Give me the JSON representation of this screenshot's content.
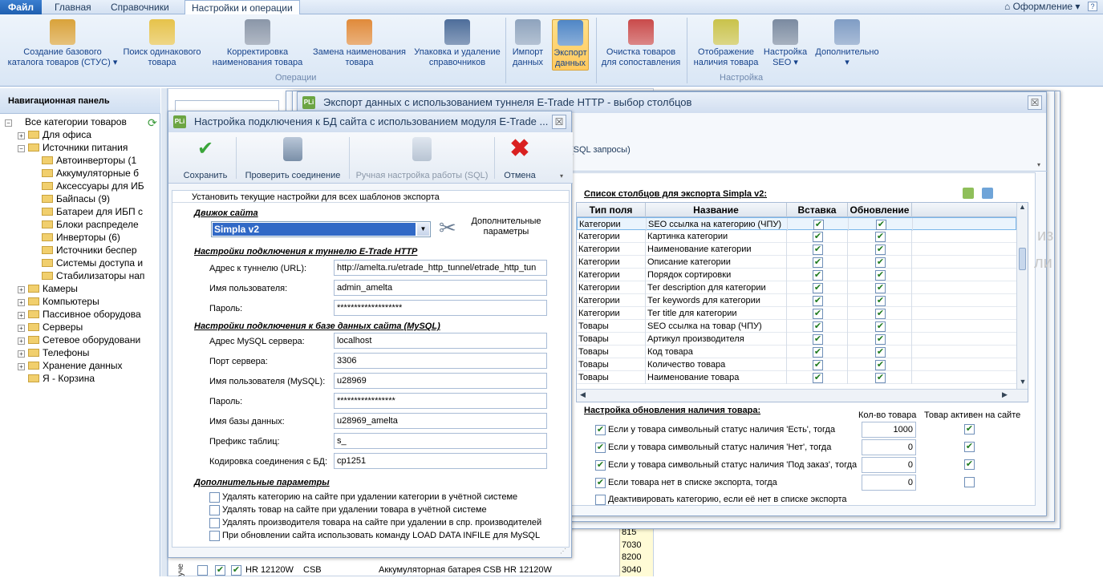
{
  "tabs": {
    "file": "Файл",
    "home": "Главная",
    "refs": "Справочники",
    "settings": "Настройки и операции",
    "design": "Оформление"
  },
  "ribbon": {
    "groups": {
      "operations": "Операции",
      "settings": "Настройка"
    },
    "buttons": [
      {
        "label1": "Создание базового",
        "label2": "каталога товаров (СТУС) ▾",
        "icon": "cubes-icon"
      },
      {
        "label1": "Поиск одинакового",
        "label2": "товара",
        "icon": "search-pen-icon"
      },
      {
        "label1": "Корректировка",
        "label2": "наименования товара",
        "icon": "book-icon"
      },
      {
        "label1": "Замена наименования",
        "label2": "товара",
        "icon": "replace-icon"
      },
      {
        "label1": "Упаковка и удаление",
        "label2": "справочников",
        "icon": "database-icon"
      },
      {
        "label1": "Импорт",
        "label2": "данных",
        "icon": "database-import-icon"
      },
      {
        "label1": "Экспорт",
        "label2": "данных",
        "icon": "database-export-icon"
      },
      {
        "label1": "Очистка товаров",
        "label2": "для сопоставления",
        "icon": "clean-icon"
      },
      {
        "label1": "Отображение",
        "label2": "наличия товара",
        "icon": "pencil-icon"
      },
      {
        "label1": "Настройка",
        "label2": "SEO ▾",
        "icon": "seo-icon"
      },
      {
        "label1": "Дополнительно",
        "label2": "▾",
        "icon": "document-icon"
      }
    ]
  },
  "nav": {
    "title": "Навигационная панель",
    "items": [
      {
        "label": "Все категории товаров",
        "level": 0,
        "pm": "−"
      },
      {
        "label": "Для офиса",
        "level": 1,
        "pm": "+"
      },
      {
        "label": "Источники питания",
        "level": 1,
        "pm": "−"
      },
      {
        "label": "Автоинверторы (1",
        "level": 2,
        "pm": ""
      },
      {
        "label": "Аккумуляторные б",
        "level": 2,
        "pm": ""
      },
      {
        "label": "Аксессуары для ИБ",
        "level": 2,
        "pm": ""
      },
      {
        "label": "Байпасы (9)",
        "level": 2,
        "pm": ""
      },
      {
        "label": "Батареи для ИБП с",
        "level": 2,
        "pm": ""
      },
      {
        "label": "Блоки распределе",
        "level": 2,
        "pm": ""
      },
      {
        "label": "Инверторы (6)",
        "level": 2,
        "pm": ""
      },
      {
        "label": "Источники беспер",
        "level": 2,
        "pm": ""
      },
      {
        "label": "Системы доступа и",
        "level": 2,
        "pm": ""
      },
      {
        "label": "Стабилизаторы нап",
        "level": 2,
        "pm": ""
      },
      {
        "label": "Камеры",
        "level": 1,
        "pm": "+"
      },
      {
        "label": "Компьютеры",
        "level": 1,
        "pm": "+"
      },
      {
        "label": "Пассивное оборудова",
        "level": 1,
        "pm": "+"
      },
      {
        "label": "Серверы",
        "level": 1,
        "pm": "+"
      },
      {
        "label": "Сетевое оборудовани",
        "level": 1,
        "pm": "+"
      },
      {
        "label": "Телефоны",
        "level": 1,
        "pm": "+"
      },
      {
        "label": "Хранение данных",
        "level": 1,
        "pm": "+"
      },
      {
        "label": "Я - Корзина",
        "level": 1,
        "pm": ""
      }
    ]
  },
  "back_grid": {
    "row": {
      "model": "HR 12120W",
      "brand": "CSB",
      "name": "Аккумуляторная батарея CSB HR 12120W"
    },
    "prices": [
      "815",
      "7030",
      "8200",
      "3040"
    ],
    "side_label": "уче"
  },
  "export_win": {
    "title": "Экспорт данных с использованием туннеля E-Trade HTTP - выбор столбцов",
    "sql_link": "(SQL запросы)",
    "columns_title": "Список столбцов для экспорта Simpla v2:",
    "headers": [
      "Тип поля",
      "Название",
      "Вставка",
      "Обновление"
    ],
    "rows": [
      {
        "type": "Категории",
        "name": "SEO ссылка на категорию (ЧПУ)"
      },
      {
        "type": "Категории",
        "name": "Картинка категории"
      },
      {
        "type": "Категории",
        "name": "Наименование категории"
      },
      {
        "type": "Категории",
        "name": "Описание категории"
      },
      {
        "type": "Категории",
        "name": "Порядок сортировки"
      },
      {
        "type": "Категории",
        "name": "Тег description для категории"
      },
      {
        "type": "Категории",
        "name": "Тег keywords для категории"
      },
      {
        "type": "Категории",
        "name": "Тег title для категории"
      },
      {
        "type": "Товары",
        "name": "SEO ссылка на товар (ЧПУ)"
      },
      {
        "type": "Товары",
        "name": "Артикул производителя"
      },
      {
        "type": "Товары",
        "name": "Код товара"
      },
      {
        "type": "Товары",
        "name": "Количество товара"
      },
      {
        "type": "Товары",
        "name": "Наименование товара"
      }
    ],
    "avail_title": "Настройка обновления наличия товара:",
    "qty_header": "Кол-во товара",
    "active_header": "Товар активен на сайте",
    "avail_rows": [
      {
        "label": "Если у товара символьный статус наличия 'Есть', тогда",
        "qty": "1000",
        "active": true
      },
      {
        "label": "Если у товара символьный статус наличия 'Нет', тогда",
        "qty": "0",
        "active": true
      },
      {
        "label": "Если у товара символьный статус наличия 'Под заказ', тогда",
        "qty": "0",
        "active": true
      },
      {
        "label": "Если товара нет в списке экспорта, тогда",
        "qty": "0",
        "active": false
      }
    ],
    "deactivate": "Деактивировать категорию, если её нет в списке экспорта",
    "bg_text1": "из",
    "bg_text2": "ли"
  },
  "conn_win": {
    "title": "Настройка подключения к БД сайта с использованием модуля E-Trade ...",
    "toolbar": {
      "save": "Сохранить",
      "check": "Проверить соединение",
      "manual": "Ручная настройка работы (SQL)",
      "cancel": "Отмена"
    },
    "apply_all": "Установить текущие настройки для всех шаблонов экспорта",
    "engine_title": "Движок сайта",
    "engine_value": "Simpla v2",
    "extra_params": "Дополнительные параметры",
    "tunnel_title": "Настройки подключения к туннелю E-Trade HTTP",
    "tunnel_url_label": "Адрес к туннелю (URL):",
    "tunnel_url": "http://amelta.ru/etrade_http_tunnel/etrade_http_tun",
    "user_label": "Имя пользователя:",
    "user": "admin_amelta",
    "pass_label": "Пароль:",
    "pass": "*******************",
    "mysql_title": "Настройки подключения к базе данных сайта (MySQL)",
    "host_label": "Адрес MySQL сервера:",
    "host": "localhost",
    "port_label": "Порт сервера:",
    "port": "3306",
    "dbuser_label": "Имя пользователя (MySQL):",
    "dbuser": "u28969",
    "dbpass_label": "Пароль:",
    "dbpass": "*****************",
    "dbname_label": "Имя базы данных:",
    "dbname": "u28969_amelta",
    "prefix_label": "Префикс таблиц:",
    "prefix": "s_",
    "charset_label": "Кодировка соединения с БД:",
    "charset": "cp1251",
    "extra_title": "Дополнительные параметры",
    "options": [
      "Удалять категорию на сайте при удалении категории в учётной системе",
      "Удалять товар на сайте при удалении товара в учётной системе",
      "Удалять производителя товара на сайте при удалении в спр. производителей",
      "При обновлении сайта использовать команду LOAD DATA INFILE для MySQL"
    ]
  }
}
